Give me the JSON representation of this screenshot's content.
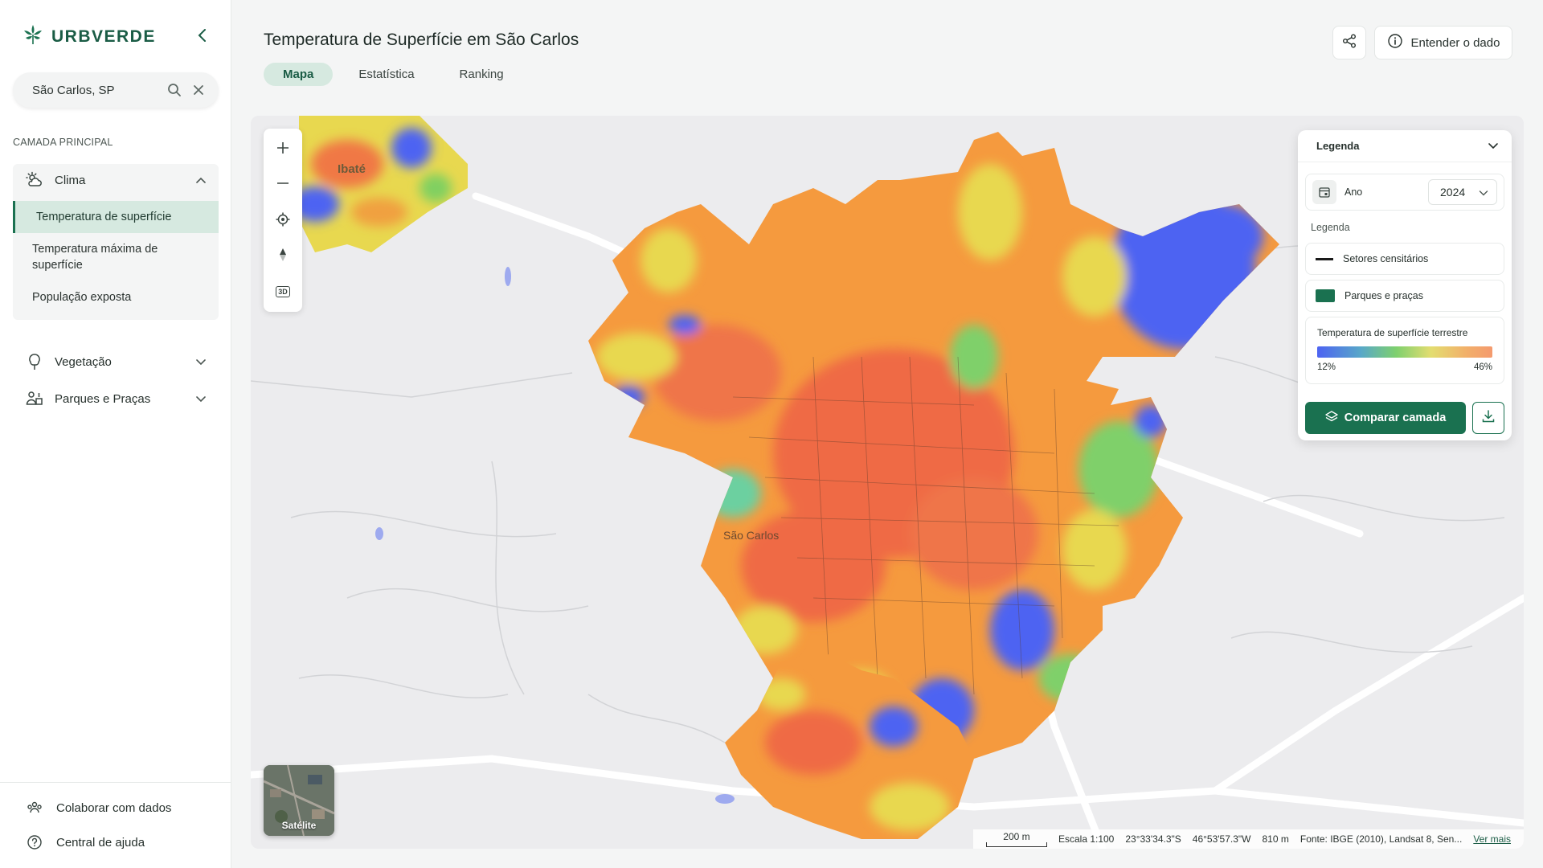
{
  "app": {
    "brand": "URBVERDE"
  },
  "search": {
    "value": "São Carlos, SP"
  },
  "sidebar": {
    "section_label": "CAMADA PRINCIPAL",
    "groups": [
      {
        "label": "Clima",
        "icon": "cloud-sun-icon",
        "expanded": true,
        "items": [
          {
            "label": "Temperatura de superfície",
            "active": true
          },
          {
            "label": "Temperatura máxima de superfície",
            "active": false
          },
          {
            "label": "População exposta",
            "active": false
          }
        ]
      },
      {
        "label": "Vegetação",
        "icon": "tree-icon",
        "expanded": false
      },
      {
        "label": "Parques e Praças",
        "icon": "park-people-icon",
        "expanded": false
      }
    ],
    "footer": [
      {
        "label": "Colaborar com dados",
        "icon": "people-network-icon"
      },
      {
        "label": "Central de ajuda",
        "icon": "help-circle-icon"
      }
    ]
  },
  "header": {
    "title": "Temperatura de Superfície em São Carlos",
    "tabs": [
      {
        "label": "Mapa",
        "active": true
      },
      {
        "label": "Estatística",
        "active": false
      },
      {
        "label": "Ranking",
        "active": false
      }
    ],
    "understand_label": "Entender o dado"
  },
  "map": {
    "place_labels": [
      "Ibaté",
      "São Carlos"
    ],
    "controls": [
      "zoom-in",
      "zoom-out",
      "locate",
      "compass",
      "3D"
    ],
    "control_3d_label": "3D",
    "satellite_label": "Satélite",
    "scale_label": "200 m",
    "scale_ratio": "Escala 1:100",
    "lat": "23°33'34.3\"S",
    "lon": "46°53'57.3\"W",
    "elevation": "810 m",
    "source": "Fonte: IBGE (2010), Landsat 8, Sen...",
    "more_link": "Ver mais"
  },
  "legend_panel": {
    "title": "Legenda",
    "year_label": "Ano",
    "year_value": "2024",
    "legend_sub": "Legenda",
    "items": [
      {
        "label": "Setores censitários",
        "swatch": "#1a1a1a"
      },
      {
        "label": "Parques e praças",
        "swatch": "#1a7150"
      }
    ],
    "gradient_title": "Temperatura de superfície terrestre",
    "gradient_min": "12%",
    "gradient_max": "46%",
    "gradient_colors": [
      "#4d63f2",
      "#58a8c8",
      "#7ed06e",
      "#e3dd70",
      "#f2b06a",
      "#f49a6e"
    ],
    "compare_label": "Comparar camada"
  },
  "colors": {
    "brand": "#1a5c45",
    "accent": "#1a7150",
    "active_bg": "#d6e9e0"
  }
}
